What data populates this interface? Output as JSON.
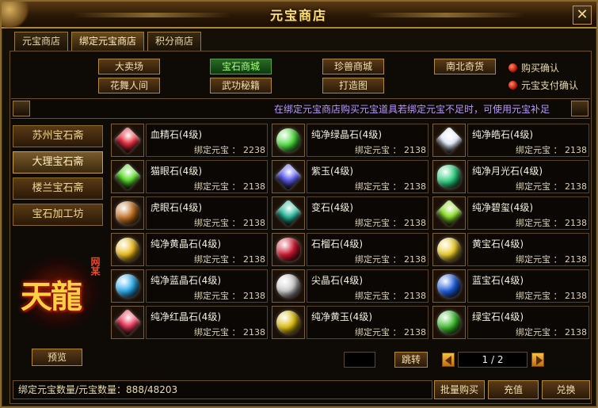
{
  "window": {
    "title": "元宝商店",
    "close_label": "✕"
  },
  "tabs": [
    {
      "label": "元宝商店",
      "active": false
    },
    {
      "label": "绑定元宝商店",
      "active": true
    },
    {
      "label": "积分商店",
      "active": false
    }
  ],
  "categories": [
    {
      "label": "大卖场",
      "active": false
    },
    {
      "label": "宝石商城",
      "active": true
    },
    {
      "label": "珍兽商城",
      "active": false
    },
    {
      "label": "南北奇货",
      "active": false
    },
    {
      "label": "花舞人间",
      "active": false
    },
    {
      "label": "武功秘籍",
      "active": false
    },
    {
      "label": "打造图",
      "active": false
    }
  ],
  "options": {
    "buy_confirm": "购买确认",
    "pay_confirm": "元宝支付确认"
  },
  "ticker": "在绑定元宝商店购买元宝道具若绑定元宝不足时，可使用元宝补足",
  "stores": [
    {
      "label": "苏州宝石斋",
      "active": false
    },
    {
      "label": "大理宝石斋",
      "active": true
    },
    {
      "label": "楼兰宝石斋",
      "active": false
    },
    {
      "label": "宝石加工坊",
      "active": false
    }
  ],
  "logo": {
    "text": "天龍",
    "mark": "网某"
  },
  "preview_label": "预览",
  "currency_label": "绑定元宝 ：",
  "items": [
    {
      "name": "血精石(4级)",
      "price": "2238",
      "color": "#e83040"
    },
    {
      "name": "纯净绿晶石(4级)",
      "price": "2138",
      "color": "#50e040"
    },
    {
      "name": "纯净皓石(4级)",
      "price": "2138",
      "color": "#e8f0ff"
    },
    {
      "name": "猫眼石(4级)",
      "price": "2138",
      "color": "#60e030"
    },
    {
      "name": "紫玉(4级)",
      "price": "2138",
      "color": "#6060f0"
    },
    {
      "name": "纯净月光石(4级)",
      "price": "2138",
      "color": "#30d080"
    },
    {
      "name": "虎眼石(4级)",
      "price": "2138",
      "color": "#c07020"
    },
    {
      "name": "变石(4级)",
      "price": "2138",
      "color": "#30c0a0"
    },
    {
      "name": "纯净碧玺(4级)",
      "price": "2138",
      "color": "#90e030"
    },
    {
      "name": "纯净黄晶石(4级)",
      "price": "2138",
      "color": "#f0c020"
    },
    {
      "name": "石榴石(4级)",
      "price": "2138",
      "color": "#d01830"
    },
    {
      "name": "黄宝石(4级)",
      "price": "2138",
      "color": "#f0d030"
    },
    {
      "name": "纯净蓝晶石(4级)",
      "price": "2138",
      "color": "#30b0f0"
    },
    {
      "name": "尖晶石(4级)",
      "price": "2138",
      "color": "#d0d0d0"
    },
    {
      "name": "蓝宝石(4级)",
      "price": "2138",
      "color": "#2060e0"
    },
    {
      "name": "纯净红晶石(4级)",
      "price": "2138",
      "color": "#f04060"
    },
    {
      "name": "纯净黄玉(4级)",
      "price": "2138",
      "color": "#e0c010"
    },
    {
      "name": "绿宝石(4级)",
      "price": "2138",
      "color": "#40c030"
    }
  ],
  "pagination": {
    "jump_label": "跳转",
    "jump_value": "",
    "page": "1 / 2"
  },
  "bottom": {
    "balance": "绑定元宝数量/元宝数量：888/48203",
    "bulk_buy": "批量购买",
    "recharge": "充值",
    "exchange": "兑换"
  }
}
